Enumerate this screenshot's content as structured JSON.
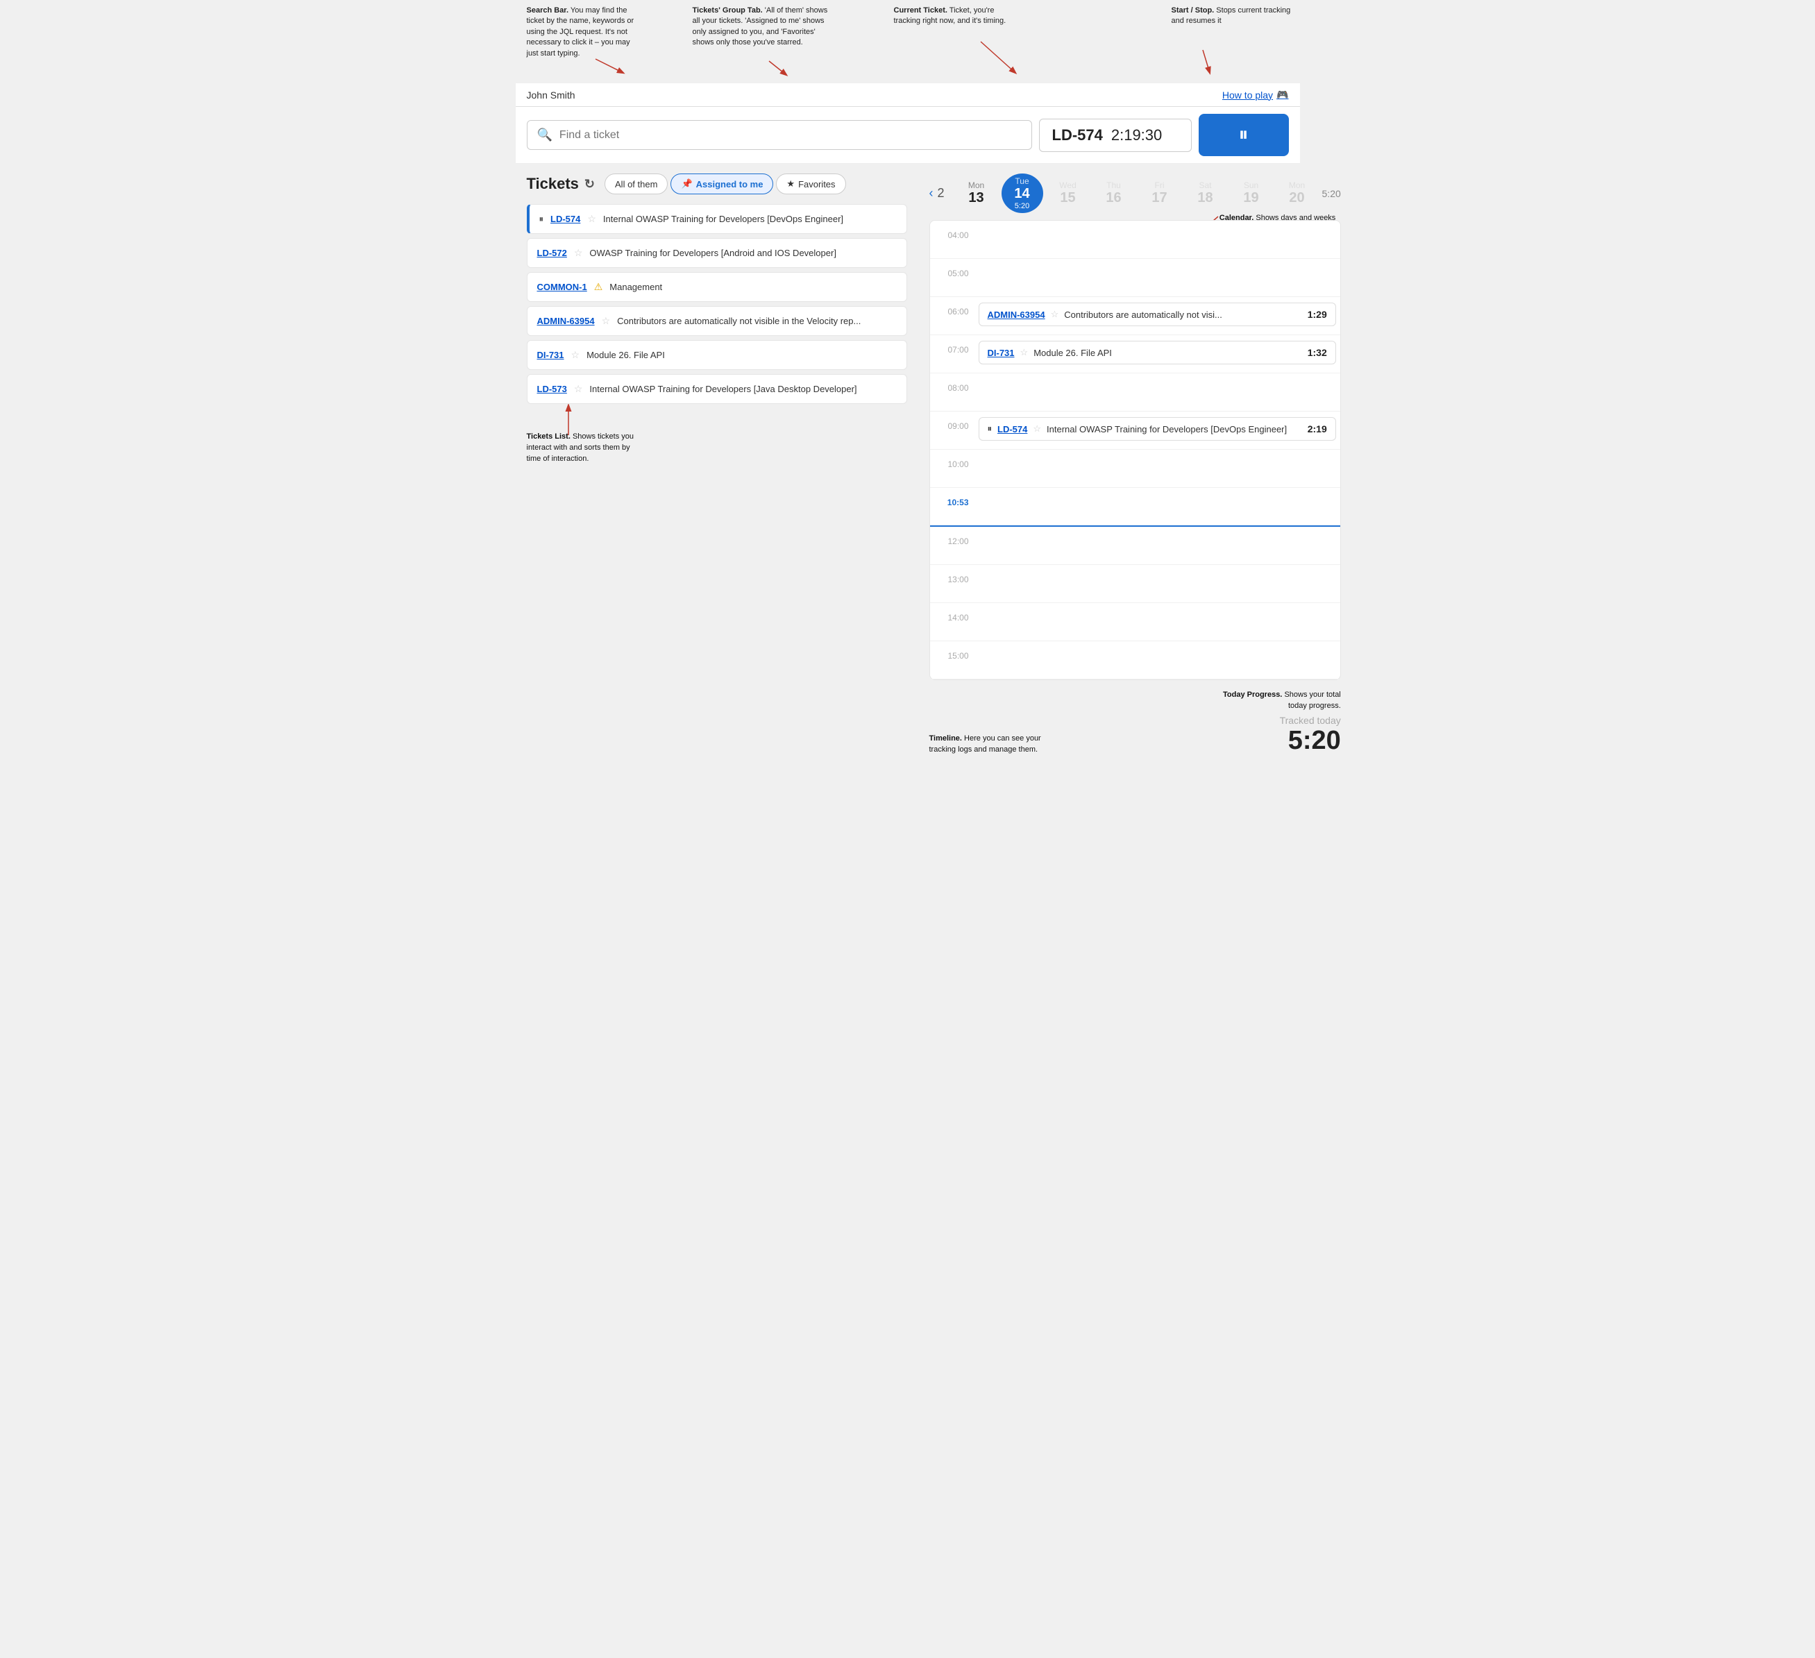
{
  "user": {
    "name": "John Smith"
  },
  "how_to_play": "How to play",
  "search": {
    "placeholder": "Find a ticket"
  },
  "current_ticket": {
    "id": "LD-574",
    "time": "2:19:30"
  },
  "stop_start_btn": "⏸",
  "tickets_title": "Tickets",
  "tabs": [
    {
      "id": "all",
      "label": "All of them",
      "icon": "",
      "active": false
    },
    {
      "id": "assigned",
      "label": "Assigned to me",
      "icon": "📌",
      "active": true
    },
    {
      "id": "favorites",
      "label": "Favorites",
      "icon": "★",
      "active": false
    }
  ],
  "ticket_list": [
    {
      "id": "LD-574",
      "desc": "Internal OWASP Training for Developers [DevOps Engineer]",
      "star": "☆",
      "active": true,
      "paused": true
    },
    {
      "id": "LD-572",
      "desc": "OWASP Training for Developers [Android and IOS Developer]",
      "star": "☆",
      "active": false,
      "paused": false
    },
    {
      "id": "COMMON-1",
      "desc": "Management",
      "star": "⚠",
      "active": false,
      "paused": false,
      "warning": true
    },
    {
      "id": "ADMIN-63954",
      "desc": "Contributors are automatically not visible in the Velocity rep...",
      "star": "☆",
      "active": false,
      "paused": false
    },
    {
      "id": "DI-731",
      "desc": "Module 26. File API",
      "star": "☆",
      "active": false,
      "paused": false
    },
    {
      "id": "LD-573",
      "desc": "Internal OWASP Training for Developers [Java Desktop Developer]",
      "star": "☆",
      "active": false,
      "paused": false
    }
  ],
  "calendar": {
    "week_total": "2",
    "days": [
      {
        "name": "Mon",
        "num": "13",
        "today": false,
        "future": false,
        "tracked": ""
      },
      {
        "name": "Tue",
        "num": "14",
        "today": true,
        "future": false,
        "tracked": "5:20"
      },
      {
        "name": "Wed",
        "num": "15",
        "today": false,
        "future": true,
        "tracked": ""
      },
      {
        "name": "Thu",
        "num": "16",
        "today": false,
        "future": true,
        "tracked": ""
      },
      {
        "name": "Fri",
        "num": "17",
        "today": false,
        "future": true,
        "tracked": ""
      },
      {
        "name": "Sat",
        "num": "18",
        "today": false,
        "future": true,
        "tracked": ""
      },
      {
        "name": "Sun",
        "num": "19",
        "today": false,
        "future": true,
        "tracked": ""
      },
      {
        "name": "Mon",
        "num": "20",
        "today": false,
        "future": true,
        "tracked": ""
      }
    ],
    "right_time": "5:20"
  },
  "timeline": [
    {
      "hour": "04:00",
      "entries": []
    },
    {
      "hour": "05:00",
      "entries": []
    },
    {
      "hour": "06:00",
      "entries": [
        {
          "id": "ADMIN-63954",
          "star": "☆",
          "desc": "Contributors are automatically not visi...",
          "time": "1:29",
          "paused": false
        }
      ]
    },
    {
      "hour": "07:00",
      "entries": [
        {
          "id": "DI-731",
          "star": "☆",
          "desc": "Module 26. File API",
          "time": "1:32",
          "paused": false
        }
      ]
    },
    {
      "hour": "08:00",
      "entries": []
    },
    {
      "hour": "09:00",
      "entries": [
        {
          "id": "LD-574",
          "star": "☆",
          "desc": "Internal OWASP Training for Developers [DevOps Engineer]",
          "time": "2:19",
          "paused": true
        }
      ]
    },
    {
      "hour": "10:00",
      "entries": []
    },
    {
      "hour": "10:53",
      "current": true,
      "entries": []
    },
    {
      "hour": "12:00",
      "entries": []
    },
    {
      "hour": "13:00",
      "entries": []
    },
    {
      "hour": "14:00",
      "entries": []
    },
    {
      "hour": "15:00",
      "entries": []
    }
  ],
  "tracked_today": {
    "label": "Tracked today",
    "value": "5:20"
  },
  "annotations": {
    "search_bar": {
      "title": "Search Bar.",
      "text": "You may find the ticket by the name, keywords or using the JQL request. It's not necessary to click it – you may just start typing."
    },
    "tickets_group_tab": {
      "title": "Tickets' Group Tab.",
      "text": "'All of them' shows all your tickets. 'Assigned to me' shows only assigned to you, and 'Favorites' shows only those you've starred."
    },
    "current_ticket": {
      "title": "Current Ticket.",
      "text": "Ticket, you're tracking right now, and it's timing."
    },
    "start_stop": {
      "title": "Start / Stop.",
      "text": "Stops current tracking and resumes it"
    },
    "calendar": {
      "title": "Calendar.",
      "text": "Shows days and weeks (including past). Days after today are not selectable."
    },
    "tickets_list": {
      "title": "Tickets List.",
      "text": "Shows tickets you interact with and sorts them by time of interaction."
    },
    "timeline": {
      "title": "Timeline.",
      "text": "Here you can see your tracking logs and manage them."
    },
    "today_progress": {
      "title": "Today Progress.",
      "text": "Shows your total today progress."
    }
  }
}
